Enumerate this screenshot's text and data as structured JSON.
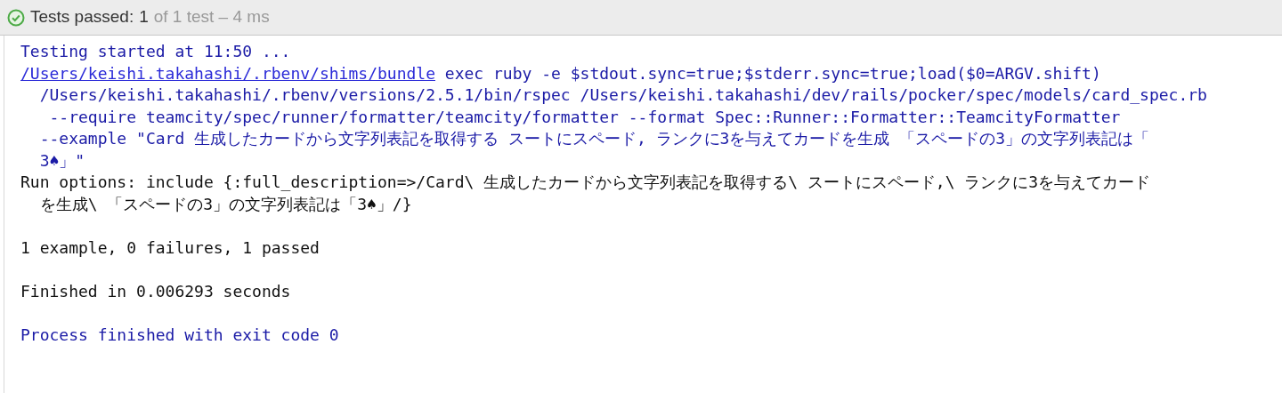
{
  "status": {
    "label": "Tests passed:",
    "count": "1",
    "detail": "of 1 test – 4 ms"
  },
  "console": [
    {
      "kind": "system",
      "text": "Testing started at 11:50 ..."
    },
    {
      "kind": "command",
      "link": "/Users/keishi.takahashi/.rbenv/shims/bundle",
      "text": " exec ruby -e $stdout.sync=true;$stderr.sync=true;load($0=ARGV.shift)"
    },
    {
      "kind": "system",
      "text": "  /Users/keishi.takahashi/.rbenv/versions/2.5.1/bin/rspec /Users/keishi.takahashi/dev/rails/pocker/spec/models/card_spec.rb"
    },
    {
      "kind": "system",
      "text": "   --require teamcity/spec/runner/formatter/teamcity/formatter --format Spec::Runner::Formatter::TeamcityFormatter"
    },
    {
      "kind": "system",
      "text": "  --example \"Card 生成したカードから文字列表記を取得する スートにスペード, ランクに3を与えてカードを生成 「スペードの3」の文字列表記は「"
    },
    {
      "kind": "system",
      "text": "  3♠」\""
    },
    {
      "kind": "output",
      "text": "Run options: include {:full_description=>/Card\\ 生成したカードから文字列表記を取得する\\ スートにスペード,\\ ランクに3を与えてカード"
    },
    {
      "kind": "output",
      "text": "  を生成\\ 「スペードの3」の文字列表記は「3♠」/}"
    },
    {
      "kind": "blank"
    },
    {
      "kind": "output",
      "text": "1 example, 0 failures, 1 passed"
    },
    {
      "kind": "blank"
    },
    {
      "kind": "output",
      "text": "Finished in 0.006293 seconds"
    },
    {
      "kind": "blank"
    },
    {
      "kind": "system",
      "text": "Process finished with exit code 0"
    }
  ]
}
